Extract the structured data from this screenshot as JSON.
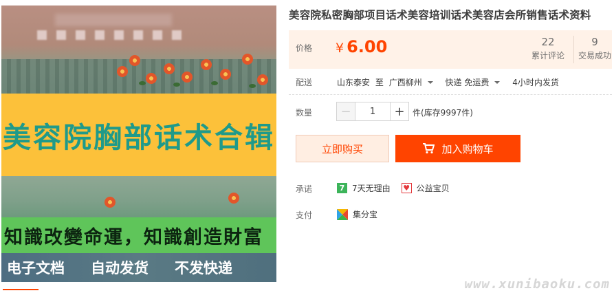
{
  "product": {
    "title": "美容院私密胸部项目话术美容培训话术美容店会所销售话术资料",
    "image": {
      "banner_text": "美容院胸部话术合辑",
      "slogan_text": "知識改變命運，知識創造財富",
      "tags": [
        "电子文档",
        "自动发货",
        "不发快递"
      ]
    }
  },
  "price": {
    "label": "价格",
    "currency": "¥",
    "value": "6.00",
    "reviews_count": "22",
    "reviews_label": "累计评论",
    "deals_count": "9",
    "deals_label": "交易成功"
  },
  "shipping": {
    "label": "配送",
    "origin": "山东泰安",
    "to": "至",
    "destination": "广西柳州",
    "method": "快递 免运费",
    "dispatch": "4小时内发货"
  },
  "quantity": {
    "label": "数量",
    "minus": "−",
    "value": "1",
    "plus": "+",
    "stock": "件(库存9997件)"
  },
  "actions": {
    "buy_now": "立即购买",
    "add_to_cart": "加入购物车"
  },
  "promise": {
    "label": "承诺",
    "items": [
      {
        "icon": "seven-day-return-icon",
        "icon_glyph": "7",
        "text": "7天无理由",
        "color": "#3cb45a"
      },
      {
        "icon": "charity-heart-icon",
        "icon_glyph": "♥",
        "text": "公益宝贝",
        "color": "#e4393c"
      }
    ]
  },
  "payment": {
    "label": "支付",
    "method": "集分宝"
  },
  "watermark": "www.xunibaoku.com",
  "colors": {
    "accent": "#ff4400",
    "price_bg": "#fff2e8",
    "banner_yellow": "#fcc13a",
    "banner_teal": "#1f9a8a",
    "slogan_green": "#5fc55a"
  }
}
